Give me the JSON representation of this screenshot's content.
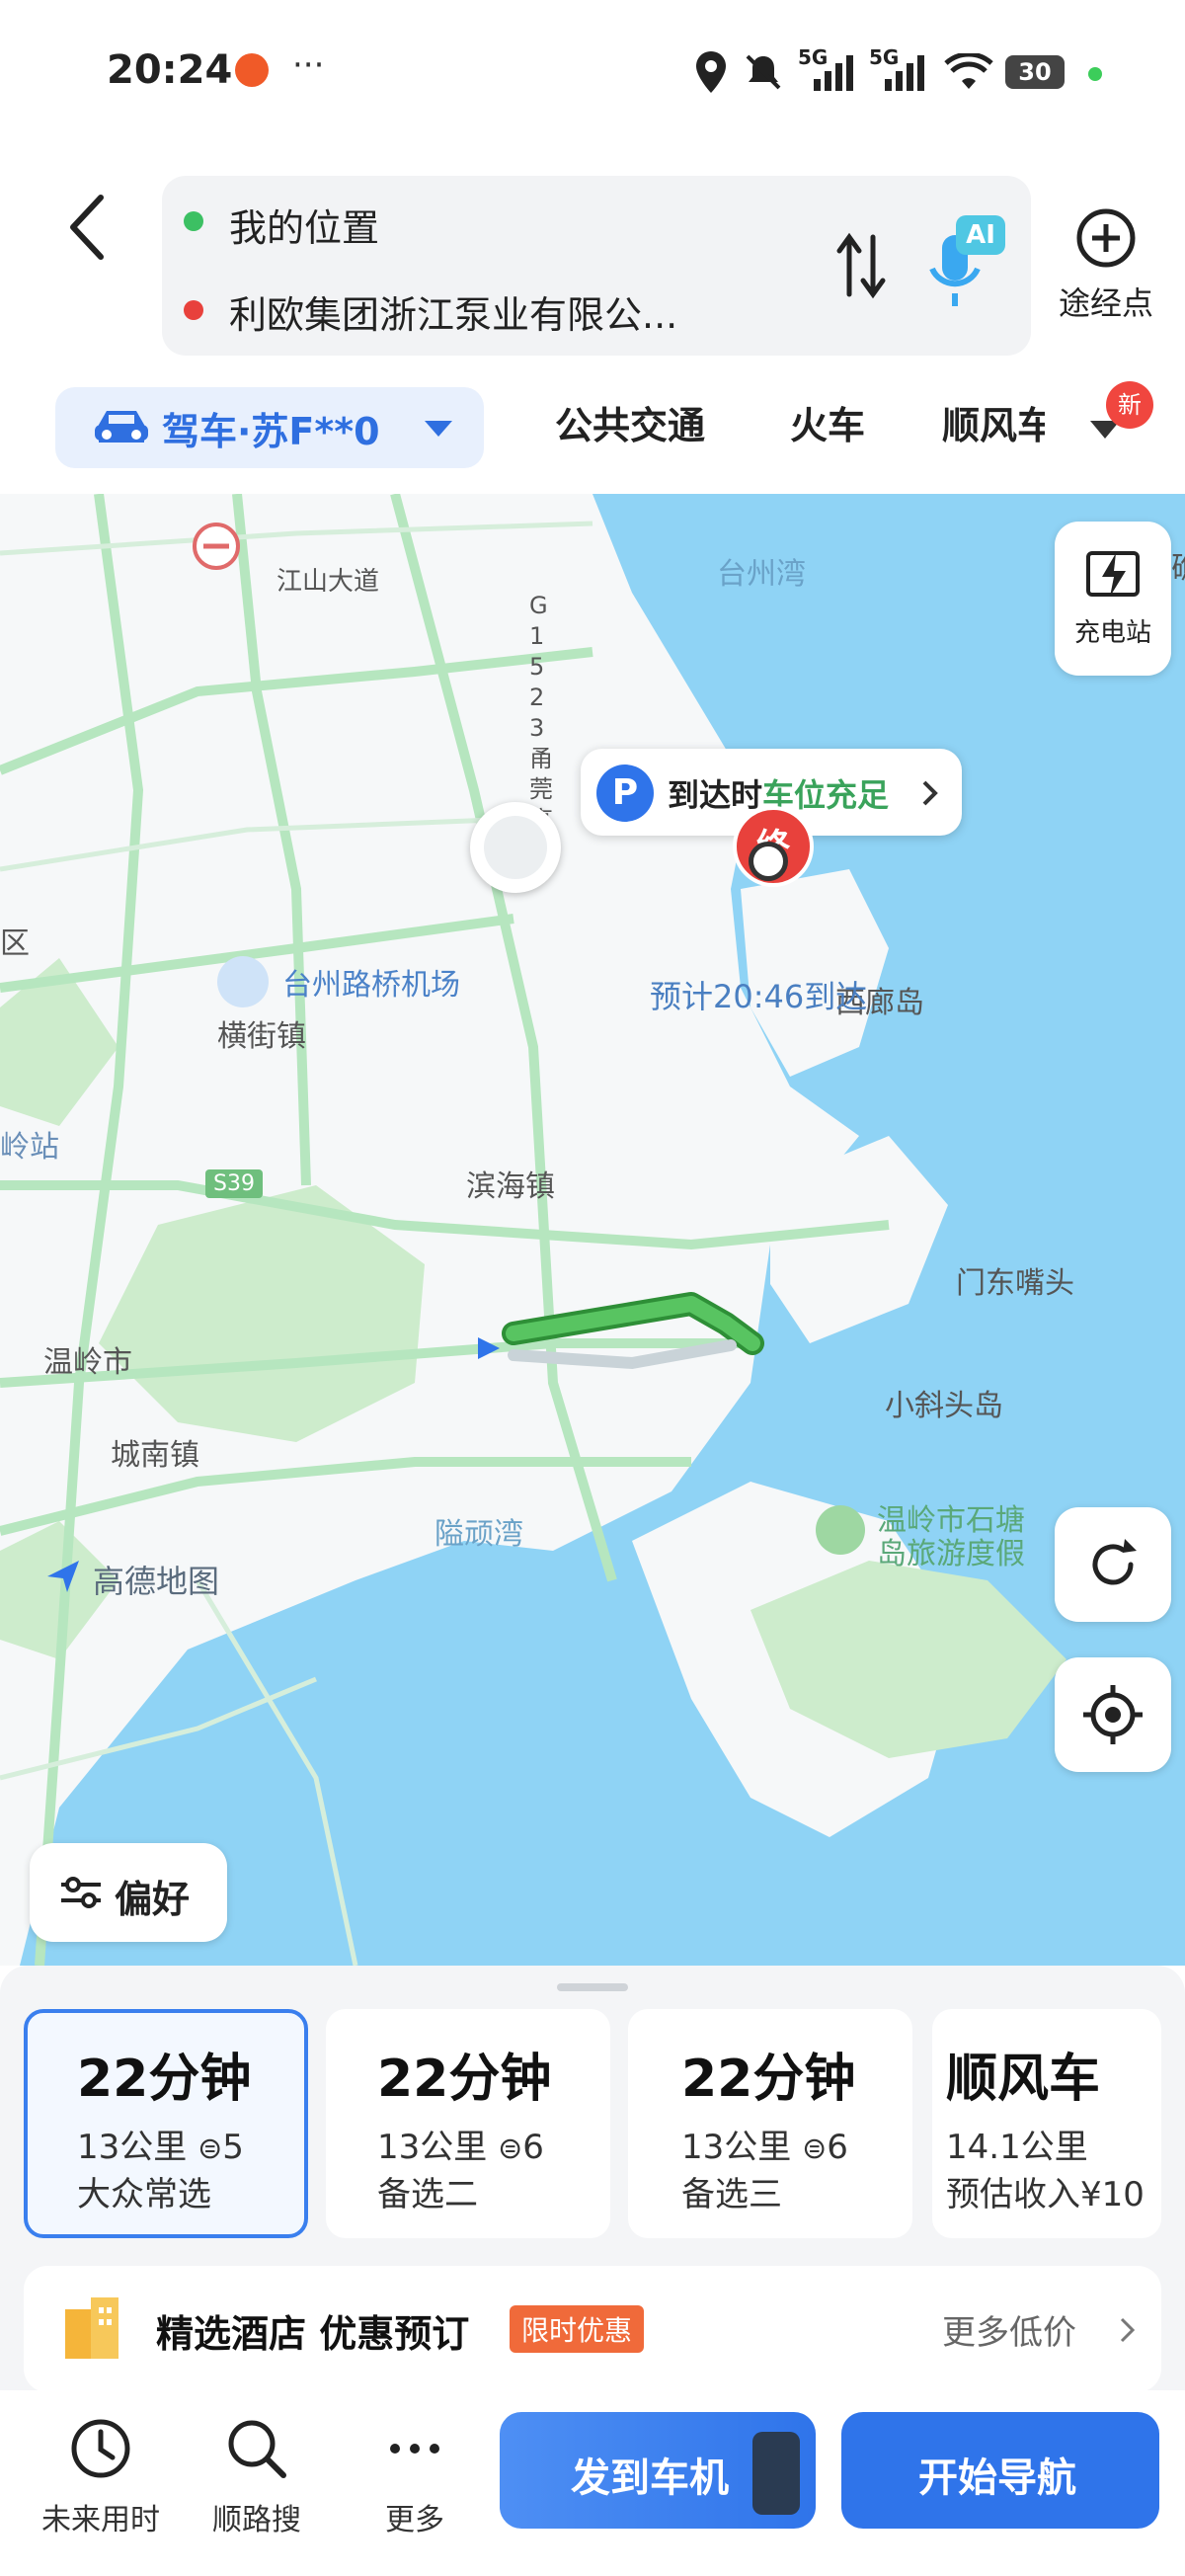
{
  "status_bar": {
    "time": "20:24",
    "more": "···",
    "network1": "5G",
    "network2": "5G",
    "battery": "30"
  },
  "route": {
    "origin": "我的位置",
    "destination": "利欧集团浙江泵业有限公...",
    "ai_badge": "AI",
    "waypoint_label": "途经点"
  },
  "modes": {
    "drive": "驾车·苏F**0",
    "transit": "公共交通",
    "train": "火车",
    "ride": "顺风车",
    "new_badge": "新"
  },
  "map": {
    "labels": {
      "taizhou_bay": "台州湾",
      "jiangshan_road": "江山大道",
      "g1523": "G1523甬莞高速",
      "airport": "台州路桥机场",
      "hengjie": "横街镇",
      "xilang": "西廊岛",
      "station": "岭站",
      "district": "区",
      "s39": "S39",
      "binhai": "滨海镇",
      "mendong": "门东嘴头",
      "wenling": "温岭市",
      "xiaoxietou": "小斜头岛",
      "chengnan": "城南镇",
      "yiwan": "隘顽湾",
      "shitang": "温岭市石塘",
      "shitang2": "岛旅游度假",
      "reef": "礁",
      "brand": "高德地图"
    },
    "parking_prefix": "到达时",
    "parking_status": "车位充足",
    "end_marker": "终",
    "eta": "预计20:46到达",
    "charging": "充电站",
    "preference": "偏好"
  },
  "routes": [
    {
      "time": "22分钟",
      "distance": "13公里",
      "lights": "5",
      "tag": "大众常选"
    },
    {
      "time": "22分钟",
      "distance": "13公里",
      "lights": "6",
      "tag": "备选二"
    },
    {
      "time": "22分钟",
      "distance": "13公里",
      "lights": "6",
      "tag": "备选三"
    },
    {
      "time": "顺风车",
      "distance": "14.1公里",
      "tag": "预估收入¥10"
    }
  ],
  "hotel": {
    "title": "精选酒店 优惠预订",
    "badge": "限时优惠",
    "more": "更多低价"
  },
  "bottom": {
    "future": "未来用时",
    "along": "顺路搜",
    "more": "更多",
    "send": "发到车机",
    "start": "开始导航"
  },
  "colors": {
    "accent": "#2f74ea",
    "route_green": "#3fae49",
    "sea": "#8fd3f5",
    "land_green": "#cdeccc"
  }
}
